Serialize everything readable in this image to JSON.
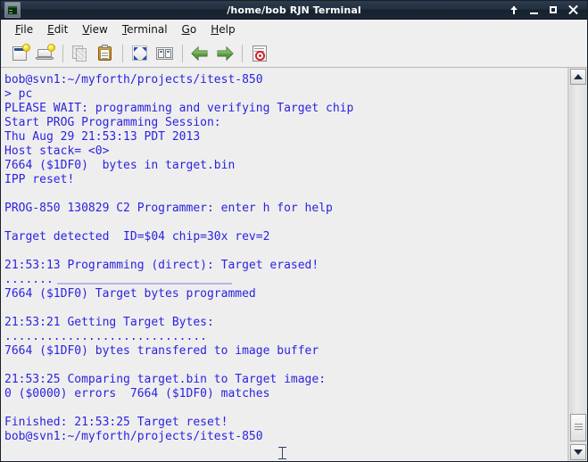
{
  "window": {
    "title": "/home/bob RJN Terminal",
    "app_icon": "terminal-icon",
    "controls": [
      {
        "name": "shade-button",
        "icon": "up-arrow-icon"
      },
      {
        "name": "minimize-button",
        "icon": "minimize-icon"
      },
      {
        "name": "maximize-button",
        "icon": "maximize-icon"
      },
      {
        "name": "close-button",
        "icon": "close-icon"
      }
    ],
    "colors": {
      "titlebar": "#22303f",
      "chrome": "#efefef",
      "terminal_bg": "#efeeee",
      "terminal_fg": "#2a24e0",
      "progress_bar": "#b9b4ee"
    }
  },
  "menubar": {
    "items": [
      {
        "label": "File",
        "accel": "F"
      },
      {
        "label": "Edit",
        "accel": "E"
      },
      {
        "label": "View",
        "accel": "V"
      },
      {
        "label": "Terminal",
        "accel": "T"
      },
      {
        "label": "Go",
        "accel": "G"
      },
      {
        "label": "Help",
        "accel": "H"
      }
    ]
  },
  "toolbar": {
    "buttons": [
      {
        "name": "new-tab-button",
        "icon": "new-tab-icon",
        "enabled": true
      },
      {
        "name": "new-window-button",
        "icon": "new-window-icon",
        "enabled": true
      },
      {
        "name": "copy-button",
        "icon": "copy-icon",
        "enabled": false
      },
      {
        "name": "paste-button",
        "icon": "paste-icon",
        "enabled": true
      },
      {
        "name": "fullscreen-button",
        "icon": "fullscreen-icon",
        "enabled": true
      },
      {
        "name": "split-view-button",
        "icon": "split-window-icon",
        "enabled": true
      },
      {
        "name": "previous-tab-button",
        "icon": "green-left-arrow-icon",
        "enabled": true
      },
      {
        "name": "next-tab-button",
        "icon": "green-right-arrow-icon",
        "enabled": true
      },
      {
        "name": "reset-terminal-button",
        "icon": "reset-document-icon",
        "enabled": true
      }
    ]
  },
  "terminal": {
    "lines": [
      {
        "type": "text",
        "text": "bob@svn1:~/myforth/projects/itest-850"
      },
      {
        "type": "text",
        "text": "> pc"
      },
      {
        "type": "text",
        "text": "PLEASE WAIT: programming and verifying Target chip"
      },
      {
        "type": "text",
        "text": "Start PROG Programming Session:"
      },
      {
        "type": "text",
        "text": "Thu Aug 29 21:53:13 PDT 2013"
      },
      {
        "type": "text",
        "text": "Host stack= <0>"
      },
      {
        "type": "text",
        "text": "7664 ($1DF0)  bytes in target.bin"
      },
      {
        "type": "text",
        "text": "IPP reset!"
      },
      {
        "type": "blank",
        "text": ""
      },
      {
        "type": "text",
        "text": "PROG-850 130829 C2 Programmer: enter h for help"
      },
      {
        "type": "blank",
        "text": ""
      },
      {
        "type": "text",
        "text": "Target detected  ID=$04 chip=30x rev=2"
      },
      {
        "type": "blank",
        "text": ""
      },
      {
        "type": "text",
        "text": "21:53:13 Programming (direct): Target erased!"
      },
      {
        "type": "progress",
        "text": "......."
      },
      {
        "type": "text",
        "text": "7664 ($1DF0) Target bytes programmed"
      },
      {
        "type": "blank",
        "text": ""
      },
      {
        "type": "text",
        "text": "21:53:21 Getting Target Bytes:"
      },
      {
        "type": "text",
        "text": "............................."
      },
      {
        "type": "text",
        "text": "7664 ($1DF0) bytes transfered to image buffer"
      },
      {
        "type": "blank",
        "text": ""
      },
      {
        "type": "text",
        "text": "21:53:25 Comparing target.bin to Target image:"
      },
      {
        "type": "text",
        "text": "0 ($0000) errors  7664 ($1DF0) matches"
      },
      {
        "type": "blank",
        "text": ""
      },
      {
        "type": "text",
        "text": "Finished: 21:53:25 Target reset!"
      },
      {
        "type": "text",
        "text": "bob@svn1:~/myforth/projects/itest-850"
      }
    ]
  },
  "scrollbar": {
    "up_button": "scroll-up-icon",
    "down_button": "scroll-down-icon",
    "thumb": "scrollbar-thumb"
  }
}
